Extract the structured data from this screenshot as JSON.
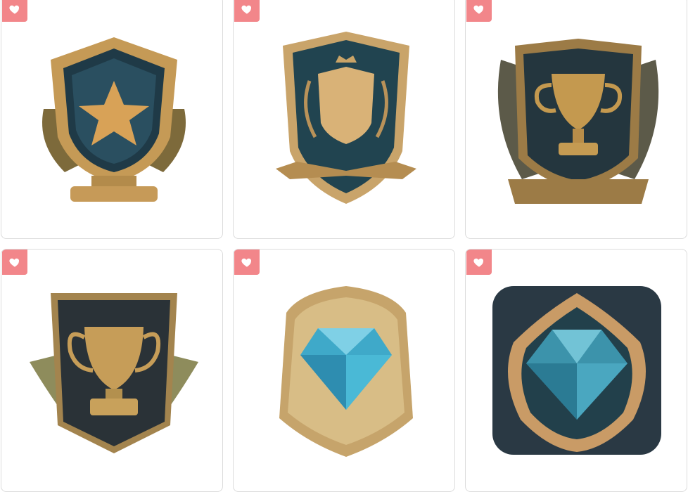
{
  "grid": {
    "items": [
      {
        "badge": "star-shield-trophy",
        "favorited": true
      },
      {
        "badge": "crest-shield-banner",
        "favorited": true
      },
      {
        "badge": "winged-trophy-shield",
        "favorited": true
      },
      {
        "badge": "urn-trophy-shield",
        "favorited": true
      },
      {
        "badge": "diamond-gold-frame",
        "favorited": true
      },
      {
        "badge": "diamond-ornate-tile",
        "favorited": true
      }
    ]
  },
  "colors": {
    "favorite_bg": "#f2868a",
    "card_border": "#dcdcdc",
    "gold": "#c8a05a",
    "dark_teal": "#1f3640",
    "gem_blue": "#3fa9c9"
  },
  "icons": {
    "favorite": "heart-icon"
  }
}
